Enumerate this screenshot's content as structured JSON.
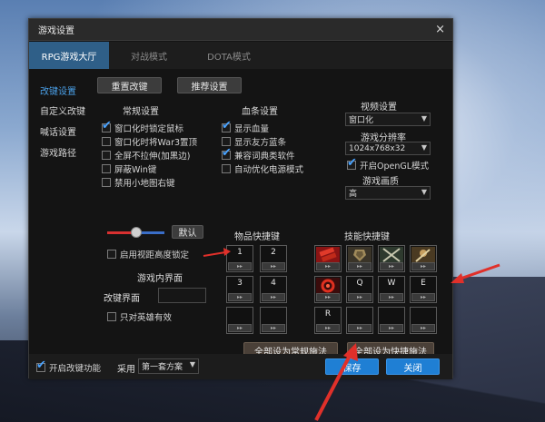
{
  "window": {
    "title": "游戏设置",
    "close_glyph": "×"
  },
  "tabs": [
    {
      "label": "RPG游戏大厅",
      "active": true
    },
    {
      "label": "对战模式",
      "active": false
    },
    {
      "label": "DOTA模式",
      "active": false
    }
  ],
  "sidebar": {
    "items": [
      {
        "label": "改键设置",
        "active": true
      },
      {
        "label": "自定义改键",
        "active": false
      },
      {
        "label": "喊话设置",
        "active": false
      },
      {
        "label": "游戏路径",
        "active": false
      }
    ]
  },
  "top_buttons": {
    "reset": "重置改键",
    "recommend": "推荐设置"
  },
  "general": {
    "title": "常规设置",
    "options": [
      {
        "label": "窗口化时锁定鼠标",
        "checked": true
      },
      {
        "label": "窗口化时将War3置顶",
        "checked": false
      },
      {
        "label": "全屏不拉伸(加黑边)",
        "checked": false
      },
      {
        "label": "屏蔽Win键",
        "checked": false
      },
      {
        "label": "禁用小地图右键",
        "checked": false
      }
    ]
  },
  "health_bar": {
    "title": "血条设置",
    "options": [
      {
        "label": "显示血量",
        "checked": true
      },
      {
        "label": "显示友方蓝条",
        "checked": false
      },
      {
        "label": "兼容词典类软件",
        "checked": true
      },
      {
        "label": "自动优化电源模式",
        "checked": false
      }
    ]
  },
  "video": {
    "title": "视频设置",
    "mode_value": "窗口化",
    "resolution_title": "游戏分辨率",
    "resolution_value": "1024x768x32",
    "opengl_label": "开启OpenGL模式",
    "opengl_checked": true,
    "quality_title": "游戏画质",
    "quality_value": "高"
  },
  "slider": {
    "default_label": "默认",
    "level_percent": 45
  },
  "view_height": {
    "label": "启用视距高度锁定",
    "checked": false
  },
  "in_game_ui": {
    "title": "游戏内界面",
    "keybind_label": "改键界面",
    "hero_only_label": "只对英雄有效",
    "hero_only_checked": false
  },
  "item_hotkeys": {
    "title": "物品快捷键",
    "slots": [
      "1",
      "2",
      "3",
      "4",
      "",
      ""
    ]
  },
  "skill_hotkeys": {
    "title": "技能快捷键",
    "slots": [
      "",
      "",
      "",
      "",
      "",
      "Q",
      "W",
      "E",
      "R",
      "",
      "",
      ""
    ]
  },
  "bulk_buttons": {
    "normal": "全部设为常规施法",
    "quick": "全部设为快捷施法"
  },
  "footer": {
    "enable_label": "开启改键功能",
    "enable_checked": true,
    "use_label": "采用",
    "scheme_value": "第一套方案",
    "save": "保存",
    "close": "关闭"
  },
  "colors": {
    "accent": "#2f5f88",
    "button_blue": "#1f7fd4",
    "annotation_arrow": "#e0302a"
  }
}
